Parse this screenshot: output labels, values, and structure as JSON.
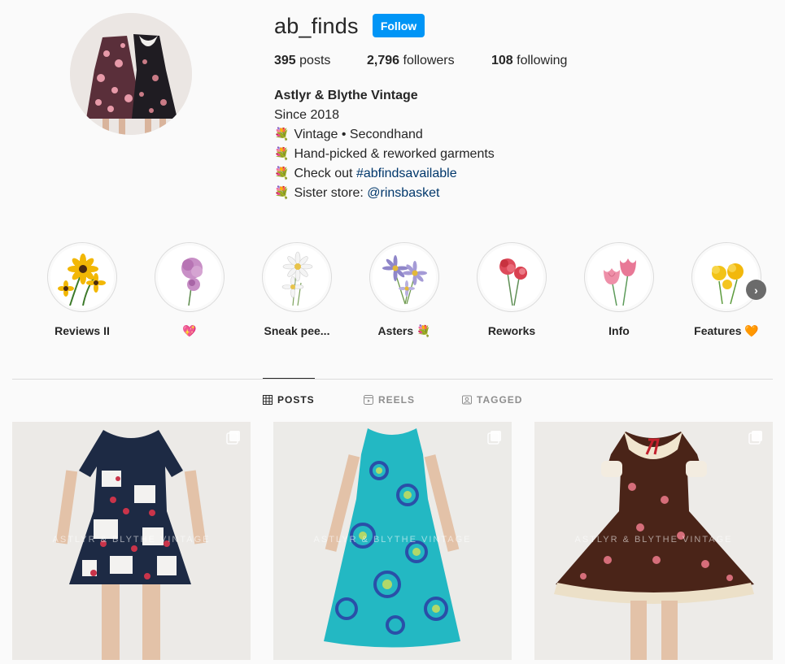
{
  "profile": {
    "username": "ab_finds",
    "follow_label": "Follow",
    "stats": {
      "posts_count": "395",
      "posts_label": "posts",
      "followers_count": "2,796",
      "followers_label": "followers",
      "following_count": "108",
      "following_label": "following"
    },
    "bio": {
      "name": "Astlyr & Blythe Vintage",
      "line1": "Since 2018",
      "line2_emoji": "💐",
      "line2": "Vintage • Secondhand",
      "line3_emoji": "💐",
      "line3": "Hand-picked & reworked garments",
      "line4_emoji": "💐",
      "line4_prefix": "Check out ",
      "line4_link": "#abfindsavailable",
      "line5_emoji": "💐",
      "line5_prefix": "Sister store: ",
      "line5_link": "@rinsbasket"
    }
  },
  "highlights": [
    {
      "label": "Reviews II",
      "icon": "sunflower-icon"
    },
    {
      "label": "💖",
      "icon": "peony-icon"
    },
    {
      "label": "Sneak pee...",
      "icon": "daisy-icon"
    },
    {
      "label": "Asters 💐",
      "icon": "aster-icon"
    },
    {
      "label": "Reworks",
      "icon": "carnation-icon"
    },
    {
      "label": "Info",
      "icon": "tulip-icon"
    },
    {
      "label": "Features 🧡",
      "icon": "yellow-flower-icon"
    }
  ],
  "tabs": [
    {
      "label": "POSTS",
      "icon": "grid-icon",
      "active": true
    },
    {
      "label": "REELS",
      "icon": "reels-icon",
      "active": false
    },
    {
      "label": "TAGGED",
      "icon": "tagged-icon",
      "active": false
    }
  ],
  "posts": [
    {
      "watermark": "ASTLYR & BLYTHE VINTAGE",
      "icon": "carousel-icon"
    },
    {
      "watermark": "ASTLYR & BLYTHE VINTAGE",
      "icon": "carousel-icon"
    },
    {
      "watermark": "ASTLYR & BLYTHE VINTAGE",
      "icon": "carousel-icon"
    }
  ],
  "colors": {
    "accent": "#0095f6",
    "link": "#00376b",
    "text": "#262626",
    "muted": "#8e8e8e"
  }
}
